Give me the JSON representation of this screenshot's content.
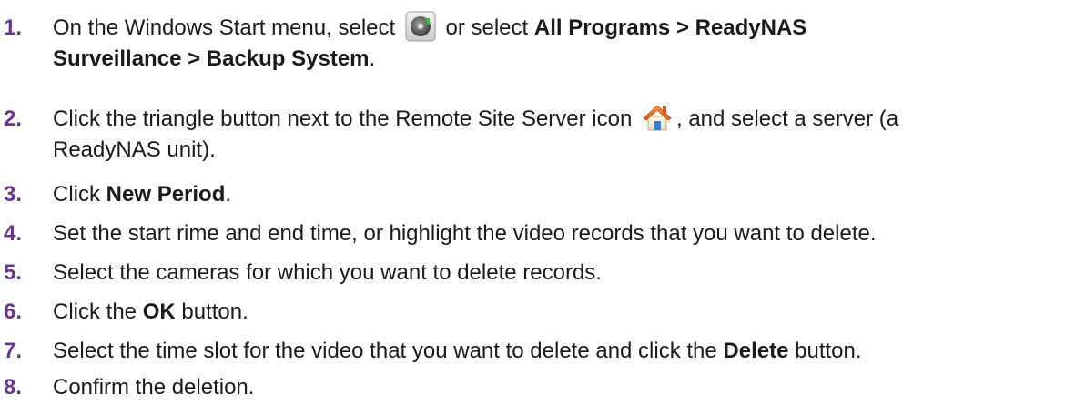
{
  "steps": [
    {
      "num": "1.",
      "a": "On the Windows Start menu, select ",
      "b": " or select ",
      "c": "All Programs > ReadyNAS",
      "d": "Surveillance > Backup System",
      "e": ".",
      "icon": "backup-system-icon"
    },
    {
      "num": "2.",
      "a": "Click the triangle button next to the Remote Site Server icon ",
      "b": ", and select a server (a",
      "c": "ReadyNAS unit).",
      "icon": "remote-site-server-icon"
    },
    {
      "num": "3.",
      "a": "Click ",
      "b": "New Period",
      "c": "."
    },
    {
      "num": "4.",
      "a": "Set the start rime and end time, or highlight the video records that you want to delete."
    },
    {
      "num": "5.",
      "a": "Select the cameras for which you want to delete records."
    },
    {
      "num": "6.",
      "a": "Click the ",
      "b": "OK",
      "c": " button."
    },
    {
      "num": "7.",
      "a": "Select the time slot for the video that you want to delete and click the ",
      "b": "Delete",
      "c": " button."
    },
    {
      "num": "8.",
      "a": "Confirm the deletion."
    }
  ],
  "colors": {
    "step_number": "#6a3590",
    "text": "#1a1a1a"
  }
}
